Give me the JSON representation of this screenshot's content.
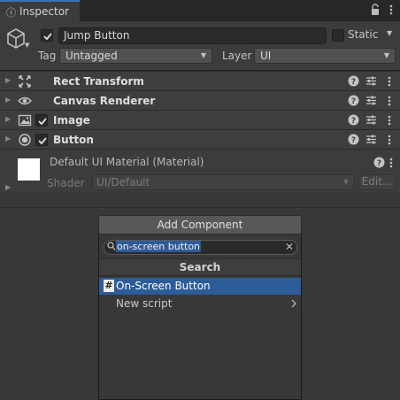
{
  "tab": {
    "title": "Inspector",
    "icon": "info-icon"
  },
  "object": {
    "name": "Jump Button",
    "active": true,
    "static_label": "Static",
    "static": false,
    "tag_label": "Tag",
    "tag_value": "Untagged",
    "layer_label": "Layer",
    "layer_value": "UI"
  },
  "components": [
    {
      "name": "Rect Transform",
      "icon": "rect-transform-icon",
      "has_toggle": false
    },
    {
      "name": "Canvas Renderer",
      "icon": "eye-icon",
      "has_toggle": false
    },
    {
      "name": "Image",
      "icon": "image-icon",
      "has_toggle": true,
      "enabled": true
    },
    {
      "name": "Button",
      "icon": "button-icon",
      "has_toggle": true,
      "enabled": true
    }
  ],
  "material": {
    "title": "Default UI Material (Material)",
    "shader_label": "Shader",
    "shader_value": "UI/Default",
    "edit_label": "Edit..."
  },
  "add_component": {
    "button_label": "Add Component",
    "search_value": "on-screen button",
    "header": "Search",
    "results": [
      {
        "label": "On-Screen Button",
        "icon": "script-icon",
        "icon_glyph": "#",
        "selected": true
      },
      {
        "label": "New script",
        "submenu": true
      }
    ]
  },
  "colors": {
    "selection": "#2c5d99",
    "tab_accent": "#3a72b0",
    "background": "#383838"
  }
}
